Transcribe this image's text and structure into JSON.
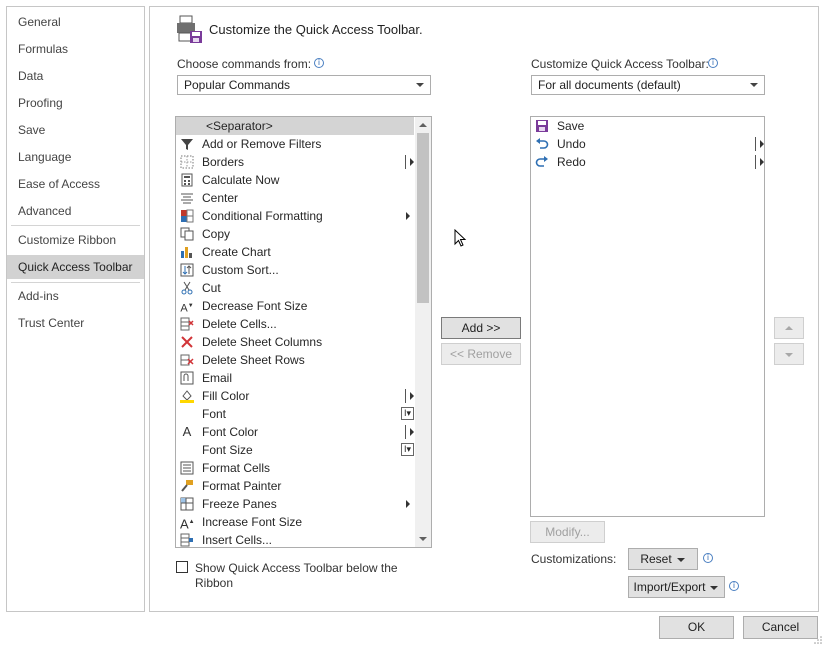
{
  "nav": {
    "items": [
      {
        "label": "General"
      },
      {
        "label": "Formulas"
      },
      {
        "label": "Data"
      },
      {
        "label": "Proofing"
      },
      {
        "label": "Save"
      },
      {
        "label": "Language"
      },
      {
        "label": "Ease of Access"
      },
      {
        "label": "Advanced"
      },
      {
        "label": "Customize Ribbon"
      },
      {
        "label": "Quick Access Toolbar"
      },
      {
        "label": "Add-ins"
      },
      {
        "label": "Trust Center"
      }
    ],
    "selected": "Quick Access Toolbar"
  },
  "header": {
    "title": "Customize the Quick Access Toolbar."
  },
  "left": {
    "label": "Choose commands from:",
    "dropdown_value": "Popular Commands",
    "commands": [
      {
        "label": "<Separator>",
        "icon": "separator"
      },
      {
        "label": "Add or Remove Filters",
        "icon": "filter-icon"
      },
      {
        "label": "Borders",
        "icon": "borders-icon"
      },
      {
        "label": "Calculate Now",
        "icon": "calculator-icon"
      },
      {
        "label": "Center",
        "icon": "center-align-icon"
      },
      {
        "label": "Conditional Formatting",
        "icon": "conditional-formatting-icon"
      },
      {
        "label": "Copy",
        "icon": "copy-icon"
      },
      {
        "label": "Create Chart",
        "icon": "chart-icon"
      },
      {
        "label": "Custom Sort...",
        "icon": "sort-icon"
      },
      {
        "label": "Cut",
        "icon": "scissors-icon"
      },
      {
        "label": "Decrease Font Size",
        "icon": "decrease-font-icon"
      },
      {
        "label": "Delete Cells...",
        "icon": "delete-cells-icon"
      },
      {
        "label": "Delete Sheet Columns",
        "icon": "delete-columns-icon"
      },
      {
        "label": "Delete Sheet Rows",
        "icon": "delete-rows-icon"
      },
      {
        "label": "Email",
        "icon": "email-icon"
      },
      {
        "label": "Fill Color",
        "icon": "fill-color-icon"
      },
      {
        "label": "Font",
        "icon": "font-icon"
      },
      {
        "label": "Font Color",
        "icon": "font-color-icon"
      },
      {
        "label": "Font Size",
        "icon": "font-size-icon"
      },
      {
        "label": "Format Cells",
        "icon": "format-cells-icon"
      },
      {
        "label": "Format Painter",
        "icon": "format-painter-icon"
      },
      {
        "label": "Freeze Panes",
        "icon": "freeze-panes-icon"
      },
      {
        "label": "Increase Font Size",
        "icon": "increase-font-icon"
      },
      {
        "label": "Insert Cells...",
        "icon": "insert-cells-icon"
      }
    ],
    "show_below_label_line1": "Show Quick Access Toolbar below the",
    "show_below_label_line2": "Ribbon"
  },
  "middle": {
    "add_label": "Add >>",
    "remove_label": "<< Remove"
  },
  "right": {
    "label": "Customize Quick Access Toolbar:",
    "dropdown_value": "For all documents (default)",
    "items": [
      {
        "label": "Save",
        "icon": "save-icon"
      },
      {
        "label": "Undo",
        "icon": "undo-icon"
      },
      {
        "label": "Redo",
        "icon": "redo-icon"
      }
    ],
    "modify_label": "Modify...",
    "customizations_label": "Customizations:",
    "reset_label": "Reset",
    "import_export_label": "Import/Export"
  },
  "footer": {
    "ok_label": "OK",
    "cancel_label": "Cancel"
  }
}
